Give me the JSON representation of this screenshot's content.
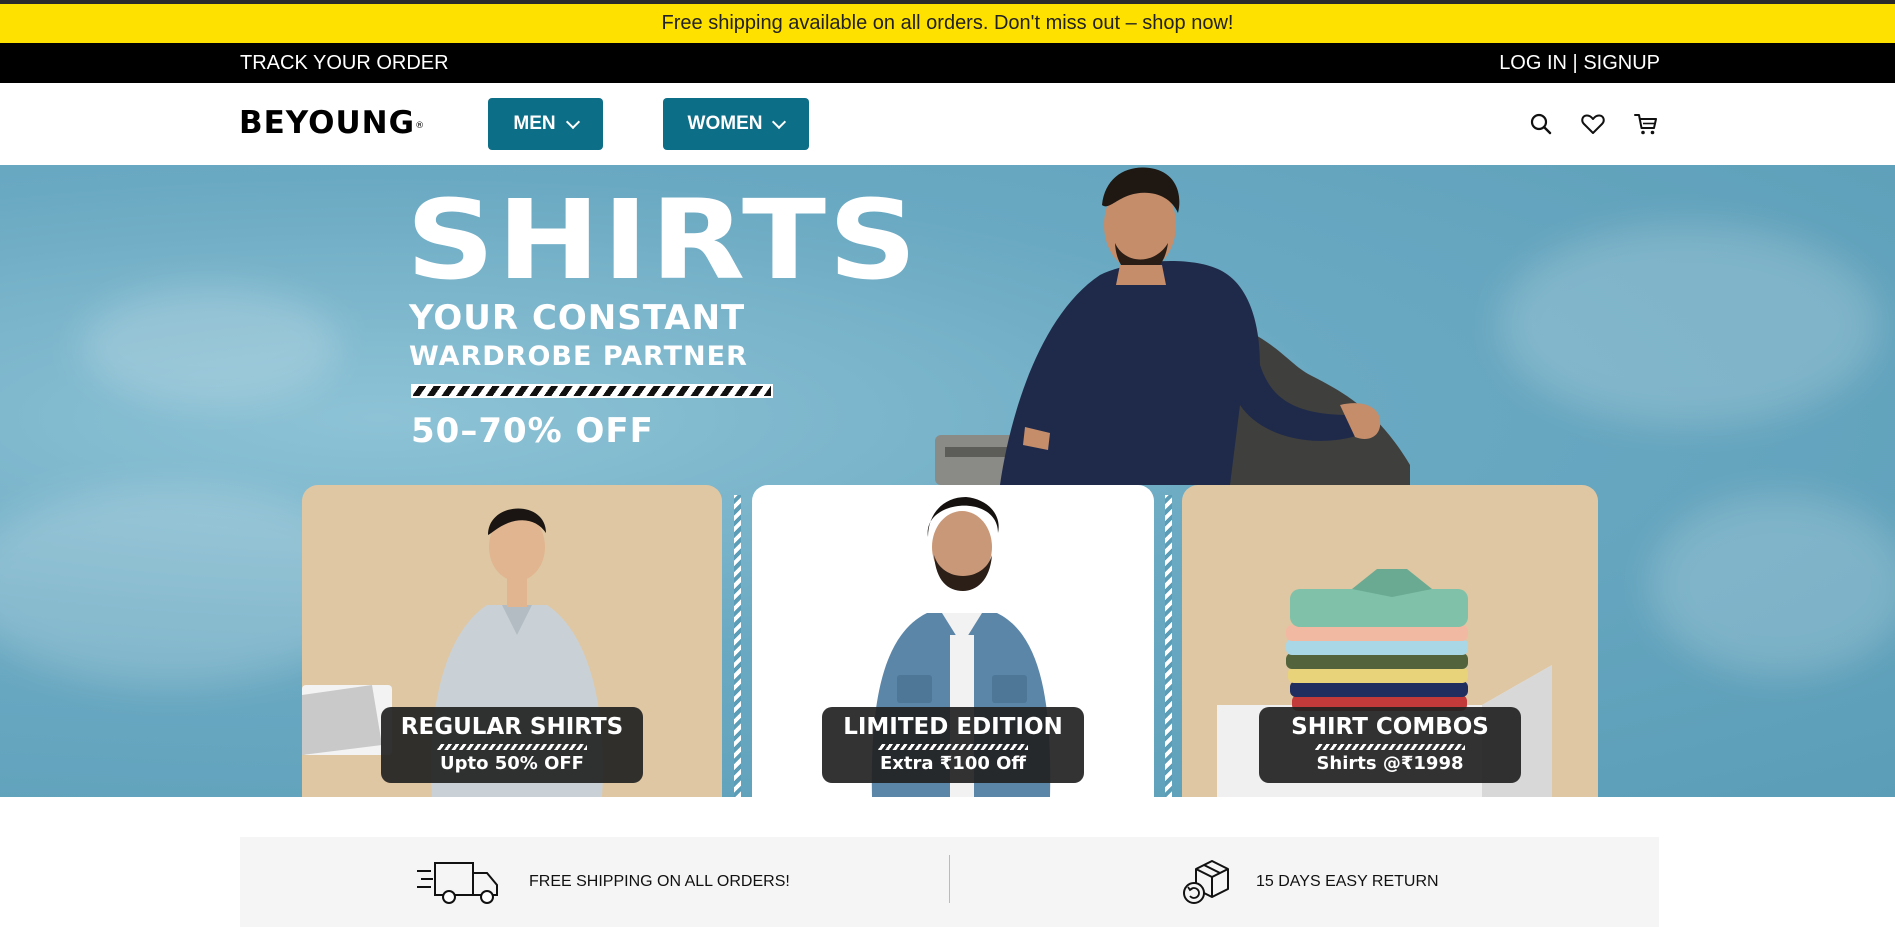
{
  "promo": {
    "text": "Free shipping available on all orders. Don't miss out – shop now!"
  },
  "top_bar": {
    "track_order": "TRACK YOUR ORDER",
    "login": "LOG IN",
    "separator": "|",
    "signup": "SIGNUP"
  },
  "header": {
    "logo": "BEYOUNG",
    "logo_mark": "®",
    "nav": [
      {
        "label": "MEN"
      },
      {
        "label": "WOMEN"
      }
    ],
    "icons": [
      "search-icon",
      "heart-icon",
      "cart-icon"
    ]
  },
  "hero": {
    "title": "SHIRTS",
    "subtitle_line1": "YOUR CONSTANT",
    "subtitle_line2": "WARDROBE PARTNER",
    "offer": "50–70% OFF",
    "cards": [
      {
        "title": "REGULAR SHIRTS",
        "subtitle": "Upto 50% OFF"
      },
      {
        "title": "LIMITED EDITION",
        "subtitle": "Extra ₹100 Off"
      },
      {
        "title": "SHIRT COMBOS",
        "subtitle": "Shirts @₹1998"
      }
    ]
  },
  "features": [
    {
      "icon": "delivery-truck-icon",
      "text": "FREE SHIPPING ON ALL ORDERS!"
    },
    {
      "icon": "return-box-icon",
      "text": "15 DAYS EASY RETURN"
    }
  ],
  "colors": {
    "promo_bg": "#ffe100",
    "top_bar_bg": "#000000",
    "nav_button": "#0d6e87",
    "hero_bg": "#6aa9c2",
    "card_beige": "#dfc7a3"
  }
}
